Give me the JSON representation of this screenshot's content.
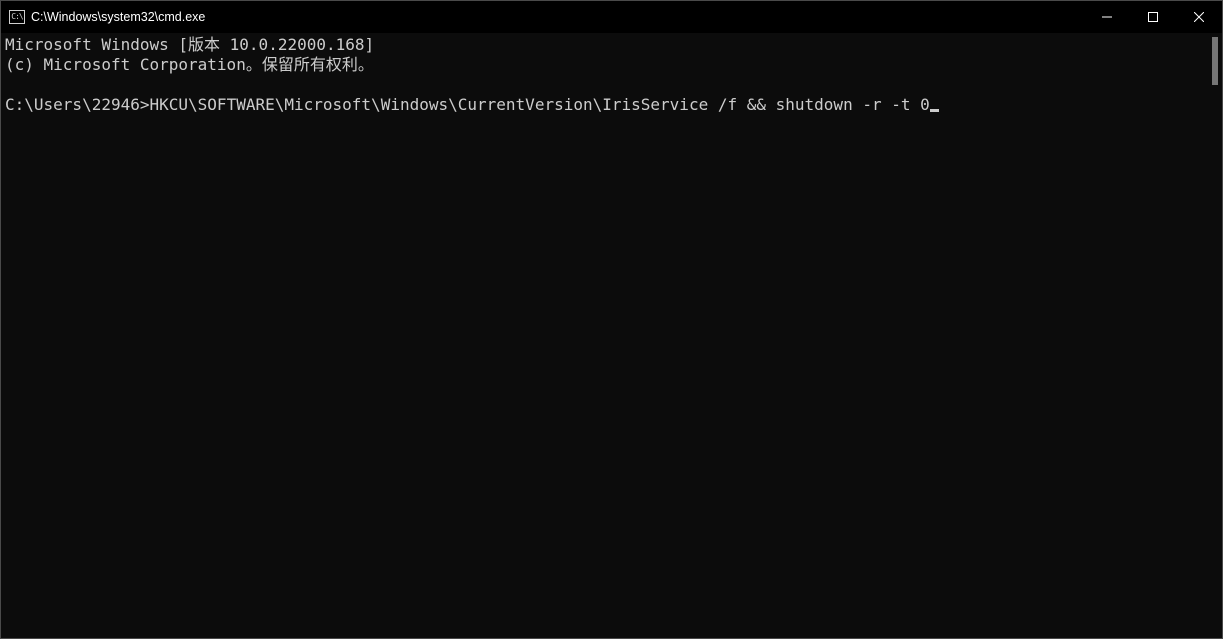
{
  "window": {
    "title": "C:\\Windows\\system32\\cmd.exe"
  },
  "terminal": {
    "line1": "Microsoft Windows [版本 10.0.22000.168]",
    "line2": "(c) Microsoft Corporation。保留所有权利。",
    "prompt": "C:\\Users\\22946>",
    "command": "HKCU\\SOFTWARE\\Microsoft\\Windows\\CurrentVersion\\IrisService /f && shutdown -r -t 0"
  }
}
